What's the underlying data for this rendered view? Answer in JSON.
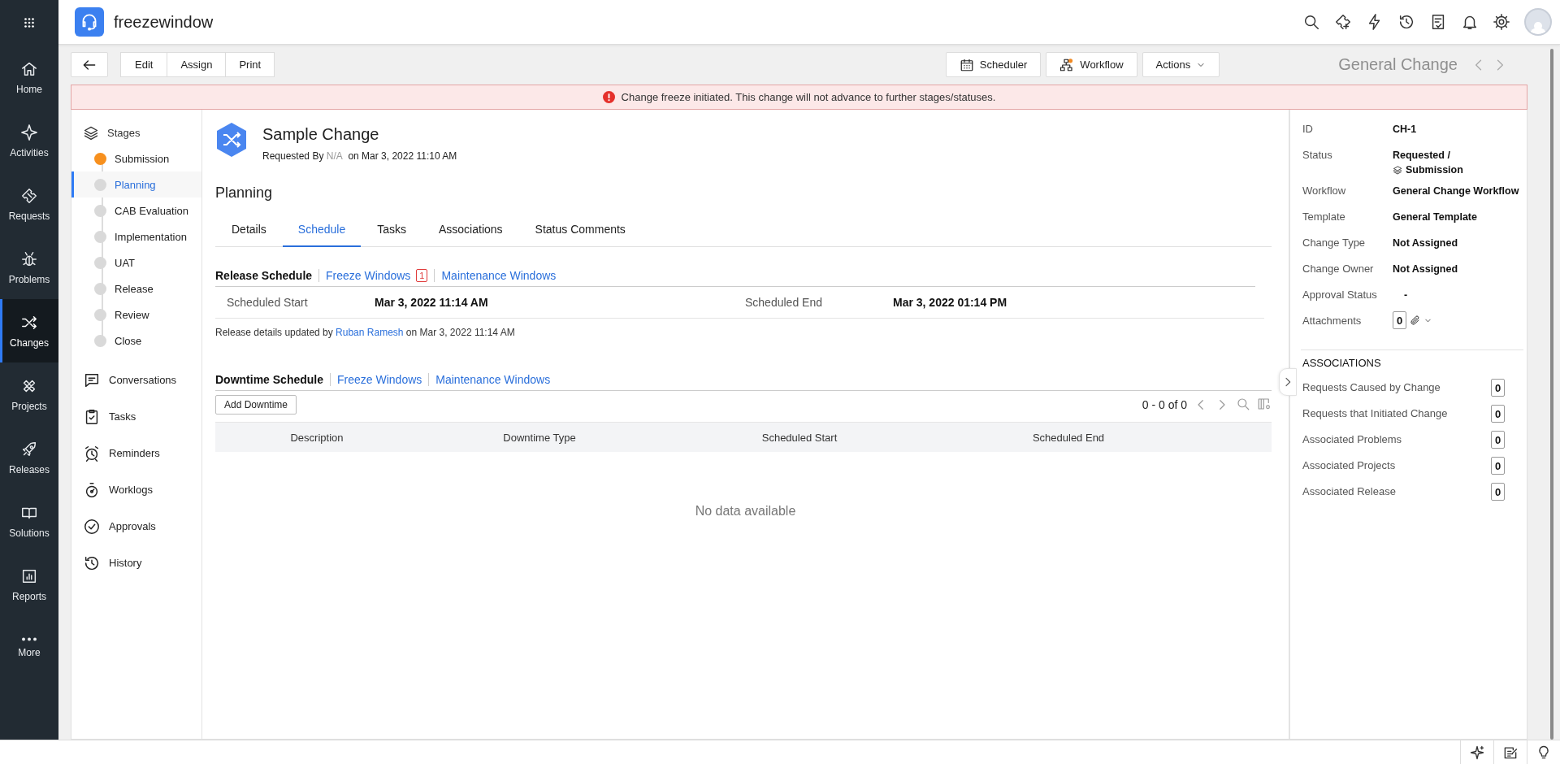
{
  "app": {
    "title": "freezewindow"
  },
  "nav": [
    {
      "label": "Home",
      "selected": false
    },
    {
      "label": "Activities",
      "selected": false
    },
    {
      "label": "Requests",
      "selected": false
    },
    {
      "label": "Problems",
      "selected": false
    },
    {
      "label": "Changes",
      "selected": true
    },
    {
      "label": "Projects",
      "selected": false
    },
    {
      "label": "Releases",
      "selected": false
    },
    {
      "label": "Solutions",
      "selected": false
    },
    {
      "label": "Reports",
      "selected": false
    },
    {
      "label": "More",
      "selected": false
    }
  ],
  "toolbar": {
    "buttons": [
      "Edit",
      "Assign",
      "Print"
    ],
    "right_buttons": [
      "Scheduler",
      "Workflow",
      "Actions"
    ],
    "record_type": "General Change"
  },
  "alert": "Change freeze initiated. This change will not advance to further stages/statuses.",
  "stages": {
    "heading": "Stages",
    "items": [
      {
        "label": "Submission",
        "selected": false,
        "current": true
      },
      {
        "label": "Planning",
        "selected": true,
        "current": false
      },
      {
        "label": "CAB Evaluation",
        "selected": false,
        "current": false
      },
      {
        "label": "Implementation",
        "selected": false,
        "current": false
      },
      {
        "label": "UAT",
        "selected": false,
        "current": false
      },
      {
        "label": "Release",
        "selected": false,
        "current": false
      },
      {
        "label": "Review",
        "selected": false,
        "current": false
      },
      {
        "label": "Close",
        "selected": false,
        "current": false
      }
    ]
  },
  "sections": [
    "Conversations",
    "Tasks",
    "Reminders",
    "Worklogs",
    "Approvals",
    "History"
  ],
  "record": {
    "title": "Sample Change",
    "requested_by": "Requested By",
    "requester": "N/A",
    "requested_on": "on Mar 3, 2022 11:10 AM"
  },
  "stage_title": "Planning",
  "tabs": [
    {
      "label": "Details",
      "selected": false
    },
    {
      "label": "Schedule",
      "selected": true
    },
    {
      "label": "Tasks",
      "selected": false
    },
    {
      "label": "Associations",
      "selected": false
    },
    {
      "label": "Status Comments",
      "selected": false
    }
  ],
  "release_schedule": {
    "title": "Release Schedule",
    "links": [
      {
        "label": "Freeze Windows",
        "badge": "1"
      },
      {
        "label": "Maintenance Windows"
      }
    ],
    "fields": [
      {
        "label": "Scheduled Start",
        "value": "Mar 3, 2022 11:14 AM"
      },
      {
        "label": "Scheduled End",
        "value": "Mar 3, 2022 01:14 PM"
      }
    ],
    "updated": {
      "prefix": "Release details updated by",
      "user": "Ruban Ramesh",
      "suffix": "on Mar 3, 2022 11:14 AM"
    }
  },
  "downtime_schedule": {
    "title": "Downtime Schedule",
    "links": [
      {
        "label": "Freeze Windows"
      },
      {
        "label": "Maintenance Windows"
      }
    ],
    "add_button": "Add Downtime",
    "pagination": "0 - 0 of 0",
    "columns": [
      "Description",
      "Downtime Type",
      "Scheduled Start",
      "Scheduled End"
    ],
    "empty": "No data available"
  },
  "details": [
    {
      "kind": "text",
      "label": "ID",
      "value": "CH-1"
    },
    {
      "kind": "status",
      "label": "Status",
      "value": "Requested /",
      "stage": "Submission"
    },
    {
      "kind": "text",
      "label": "Workflow",
      "value": "General Change Workflow"
    },
    {
      "kind": "text",
      "label": "Template",
      "value": "General Template"
    },
    {
      "kind": "text",
      "label": "Change Type",
      "value": "Not Assigned"
    },
    {
      "kind": "text",
      "label": "Change Owner",
      "value": "Not Assigned"
    },
    {
      "kind": "text",
      "label": "Approval Status",
      "value": "-"
    },
    {
      "kind": "attachments",
      "label": "Attachments",
      "value": "0"
    }
  ],
  "associations": {
    "title": "ASSOCIATIONS",
    "items": [
      {
        "label": "Requests Caused by Change",
        "count": "0"
      },
      {
        "label": "Requests that Initiated Change",
        "count": "0"
      },
      {
        "label": "Associated Problems",
        "count": "0"
      },
      {
        "label": "Associated Projects",
        "count": "0"
      },
      {
        "label": "Associated Release",
        "count": "0"
      }
    ]
  }
}
